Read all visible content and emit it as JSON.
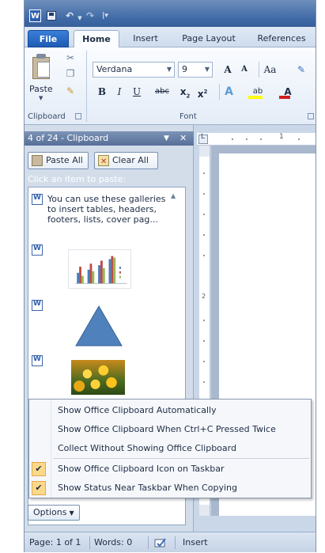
{
  "window": {
    "app_icon": "word-logo",
    "qat": {
      "save_icon": "save-icon",
      "undo_icon": "undo-icon",
      "redo_icon": "redo-icon"
    }
  },
  "tabs": {
    "file": "File",
    "home": "Home",
    "insert": "Insert",
    "page_layout": "Page Layout",
    "references": "References"
  },
  "ribbon": {
    "clipboard_group": {
      "label": "Clipboard",
      "paste_label": "Paste"
    },
    "font_group": {
      "label": "Font",
      "font_name": "Verdana",
      "font_size": "9",
      "grow": "A",
      "shrink": "A",
      "change_case": "Aa",
      "bold": "B",
      "italic": "I",
      "underline": "U",
      "strikethrough": "abc",
      "subscript": "x",
      "superscript": "x",
      "text_effects": "A",
      "highlight": "ab",
      "font_color": "A"
    }
  },
  "clipboard_pane": {
    "title": "4 of 24 - Clipboard",
    "paste_all": "Paste All",
    "clear_all": "Clear All",
    "hint": "Click an item to paste:",
    "items": [
      {
        "type": "text",
        "text": "You can use these galleries to insert tables, headers, footers, lists, cover pag..."
      },
      {
        "type": "image",
        "icon": "chart-thumbnail"
      },
      {
        "type": "image",
        "icon": "triangle-thumbnail"
      },
      {
        "type": "image",
        "icon": "flower-photo-thumbnail"
      }
    ],
    "options_button": "Options"
  },
  "options_menu": {
    "items": [
      {
        "label": "Show Office Clipboard Automatically",
        "checked": false
      },
      {
        "label": "Show Office Clipboard When Ctrl+C Pressed Twice",
        "checked": false
      },
      {
        "label": "Collect Without Showing Office Clipboard",
        "checked": false
      },
      {
        "label": "Show Office Clipboard Icon on Taskbar",
        "checked": true
      },
      {
        "label": "Show Status Near Taskbar When Copying",
        "checked": true
      }
    ]
  },
  "ruler": {
    "h_mark": "1",
    "v_mark": "2"
  },
  "status_bar": {
    "page": "Page: 1 of 1",
    "words": "Words: 0",
    "mode": "Insert"
  },
  "colors": {
    "accent": "#2d5fb0",
    "menu_check": "#fcd88a",
    "font_color": "#d11f1f",
    "highlight": "#ffff00"
  }
}
